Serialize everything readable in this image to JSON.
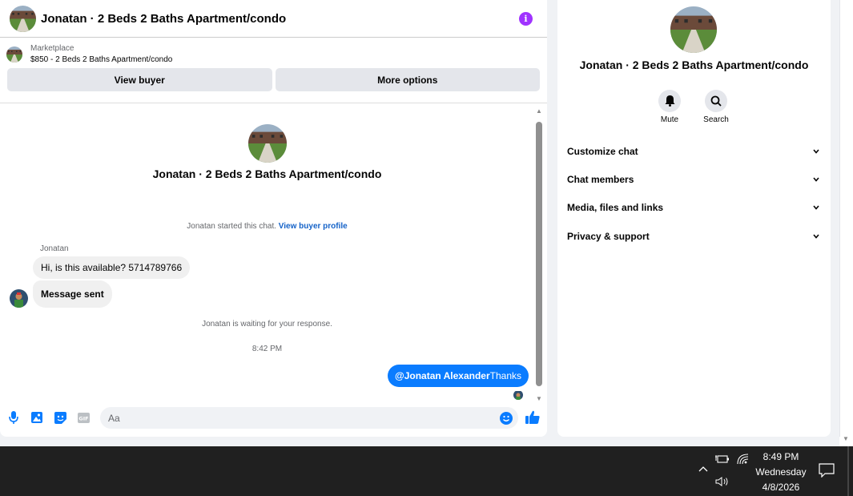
{
  "chat": {
    "header_title": "Jonatan · 2 Beds 2 Baths Apartment/condo",
    "marketplace_label": "Marketplace",
    "listing_text": "$850 - 2 Beds 2 Baths Apartment/condo",
    "view_buyer_label": "View buyer",
    "more_options_label": "More options",
    "center_title": "Jonatan · 2 Beds 2 Baths Apartment/condo",
    "started_text": "Jonatan started this chat.",
    "view_buyer_profile_link": "View buyer profile",
    "sender_name": "Jonatan",
    "messages": [
      "Hi, is this available? 5714789766",
      "Message sent"
    ],
    "waiting_text": "Jonatan is waiting for your response.",
    "timestamp": "8:42 PM",
    "outgoing_mention": "@Jonatan Alexander",
    "outgoing_text": "Thanks",
    "composer_placeholder": "Aa"
  },
  "info": {
    "title": "Jonatan · 2 Beds 2 Baths Apartment/condo",
    "mute_label": "Mute",
    "search_label": "Search",
    "menu": [
      "Customize chat",
      "Chat members",
      "Media, files and links",
      "Privacy & support"
    ]
  },
  "taskbar": {
    "time": "8:49 PM",
    "day": "Wednesday",
    "date": "4/8/2026"
  },
  "colors": {
    "messenger_blue": "#0a7cff",
    "info_purple": "#a033ff",
    "link_blue": "#1462c8",
    "taskbar_bg": "#202020"
  },
  "icons": [
    "info-icon",
    "microphone-icon",
    "image-icon",
    "sticker-icon",
    "gif-icon",
    "emoji-icon",
    "thumbs-up-icon",
    "bell-icon",
    "search-icon",
    "chevron-down-icon",
    "battery-icon",
    "wifi-icon",
    "volume-icon",
    "notification-icon"
  ]
}
